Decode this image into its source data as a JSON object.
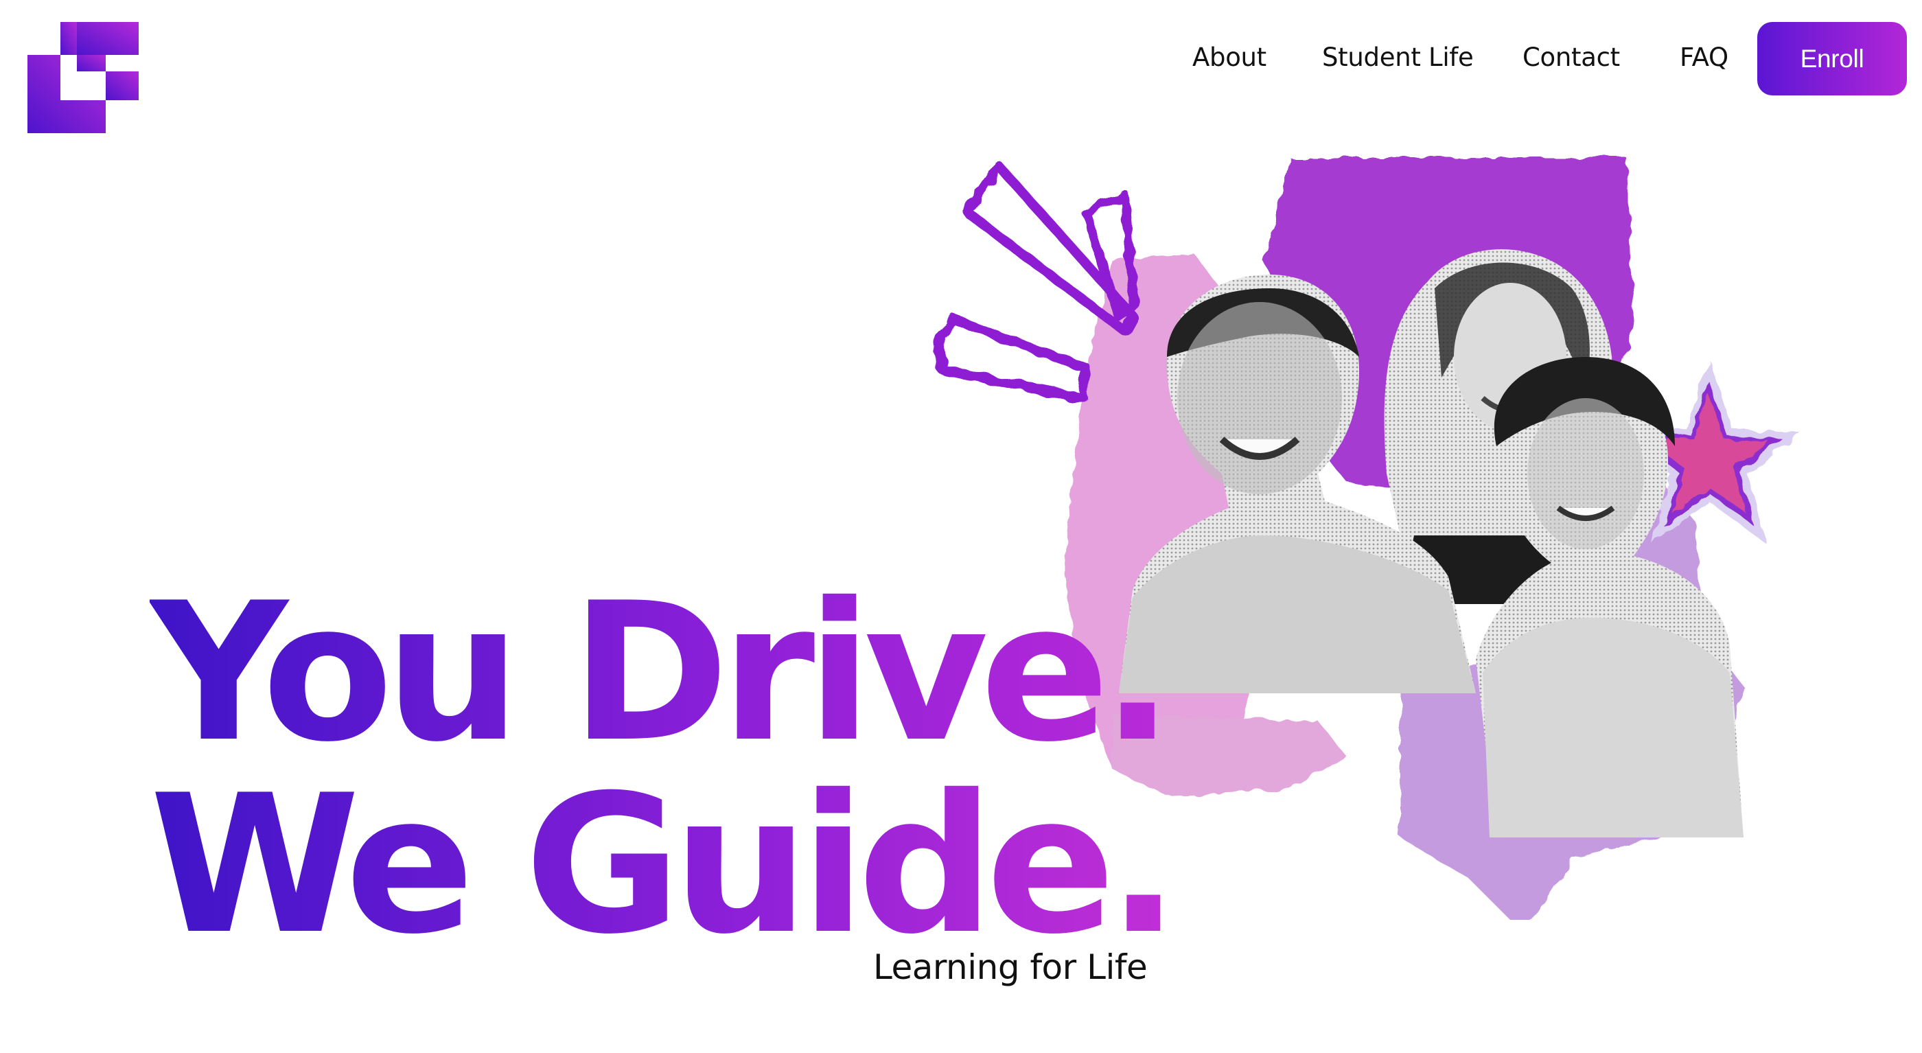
{
  "brand": {
    "logo_icon": "brand-logo-icon",
    "accent_start": "#4a14cc",
    "accent_end": "#c02ed6"
  },
  "nav": {
    "items": [
      {
        "label": "About"
      },
      {
        "label": "Student Life"
      },
      {
        "label": "Contact"
      },
      {
        "label": "FAQ"
      }
    ],
    "cta_label": "Enroll"
  },
  "hero": {
    "headline_line1": "You Drive.",
    "headline_line2": "We Guide.",
    "tagline": "Learning for Life",
    "collage": {
      "decorations": [
        "burst-strokes",
        "star-icon",
        "torn-paper-shapes"
      ],
      "photos": [
        "student-boy-photo",
        "student-girl-photo",
        "student-woman-photo"
      ]
    }
  }
}
